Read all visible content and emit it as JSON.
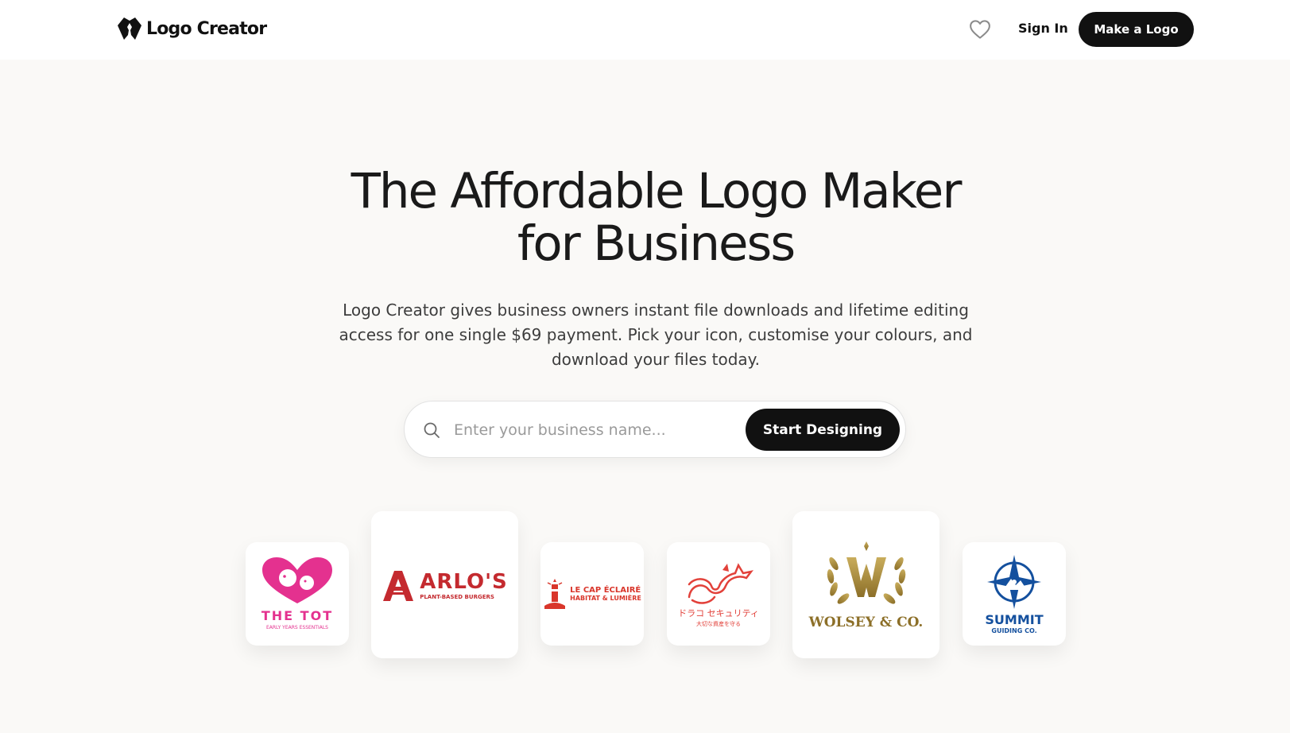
{
  "header": {
    "brand": "Logo Creator",
    "brand_icon": "logo-creator-mark",
    "favorites_icon": "heart-icon",
    "sign_in_label": "Sign In",
    "cta_label": "Make a Logo"
  },
  "hero": {
    "title_line1": "The Affordable Logo Maker",
    "title_line2": "for Business",
    "subtitle": "Logo Creator gives business owners instant file downloads and lifetime editing access for one single $69 payment. Pick your icon, customise your colours, and download your files today."
  },
  "search": {
    "icon": "search-icon",
    "placeholder": "Enter your business name...",
    "value": "",
    "button_label": "Start Designing"
  },
  "examples": [
    {
      "name": "THE TOT",
      "tagline": "EARLY YEARS ESSENTIALS",
      "color": "#e4318f"
    },
    {
      "name": "ARLO'S",
      "tagline": "PLANT-BASED BURGERS",
      "color": "#c42a2f"
    },
    {
      "name": "LE CAP ÉCLAIRÉ",
      "tagline": "HABITAT & LUMIÈRE",
      "color": "#d9362b"
    },
    {
      "name": "ドラコ セキュリティ",
      "tagline": "大切な資産を守る",
      "color": "#e2413a"
    },
    {
      "name": "WOLSEY & CO.",
      "tagline": "",
      "color": "#a8893a"
    },
    {
      "name": "SUMMIT",
      "tagline": "GUIDING CO.",
      "color": "#14509e"
    }
  ],
  "colors": {
    "background": "#faf9f7",
    "primary_button": "#111111"
  }
}
